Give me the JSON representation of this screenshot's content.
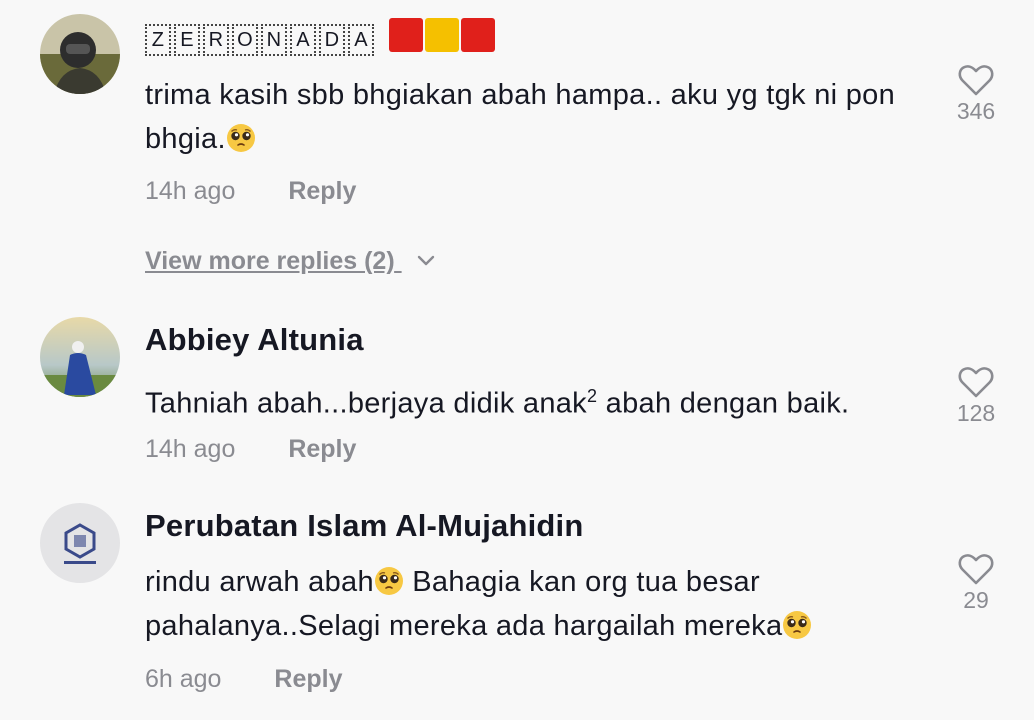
{
  "comments": [
    {
      "username_letters": [
        "Z",
        "E",
        "R",
        "O",
        "N",
        "A",
        "D",
        "A"
      ],
      "username_flags": [
        "#e0201b",
        "#f5c000",
        "#e0201b"
      ],
      "text_parts": [
        "trima kasih sbb bhgiakan abah hampa.. aku yg tgk ni pon bhgia."
      ],
      "time": "14h ago",
      "reply_label": "Reply",
      "likes": "346"
    },
    {
      "username": "Abbiey Altunia",
      "text_parts": [
        "Tahniah abah...berjaya didik anak",
        "2",
        " abah dengan baik."
      ],
      "time": "14h ago",
      "reply_label": "Reply",
      "likes": "128"
    },
    {
      "username": "Perubatan Islam Al-Mujahidin",
      "text_parts": [
        "rindu arwah abah",
        " Bahagia kan org tua besar pahalanya..Selagi mereka ada hargailah mereka"
      ],
      "time": "6h ago",
      "reply_label": "Reply",
      "likes": "29"
    }
  ],
  "view_more_replies": "View more replies (2)",
  "icons": {
    "heart": "heart-outline-icon",
    "chevron": "chevron-down-icon",
    "emoji": "pleading-face-emoji"
  },
  "colors": {
    "background": "#f8f8f8",
    "text_primary": "#161823",
    "text_secondary": "#8a8b91"
  }
}
